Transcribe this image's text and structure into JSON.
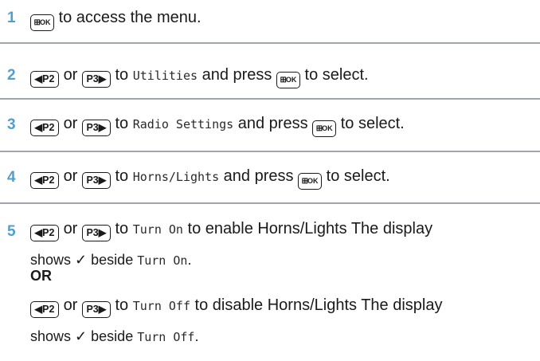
{
  "keys": {
    "menu_ok_grid": "⊞",
    "menu_ok_text": "OK",
    "p2_arrow": "◀",
    "p2_text": "P2",
    "p3_text": "P3",
    "p3_arrow": "▶"
  },
  "steps": [
    {
      "number": "1",
      "text": "to access the menu."
    },
    {
      "number": "2",
      "or": "or",
      "to": "to",
      "target": "Utilities",
      "and_press": "and press",
      "end": "to select."
    },
    {
      "number": "3",
      "or": "or",
      "to": "to",
      "target": "Radio Settings",
      "and_press": "and press",
      "end": "to select."
    },
    {
      "number": "4",
      "or": "or",
      "to": "to",
      "target": "Horns/Lights",
      "and_press": "and press",
      "end": "to select."
    },
    {
      "number": "5",
      "or": "or",
      "to": "to",
      "target": "Turn On",
      "action": "to enable Horns/Lights The display",
      "shows": "shows",
      "check": "✓",
      "beside": "beside",
      "beside_target": "Turn On",
      "period": ".",
      "alt_label": "OR",
      "alt_or": "or",
      "alt_to": "to",
      "alt_target": "Turn Off",
      "alt_action": "to disable Horns/Lights The display",
      "alt_shows": "shows",
      "alt_check": "✓",
      "alt_beside": "beside",
      "alt_beside_target": "Turn Off",
      "alt_period": "."
    }
  ]
}
